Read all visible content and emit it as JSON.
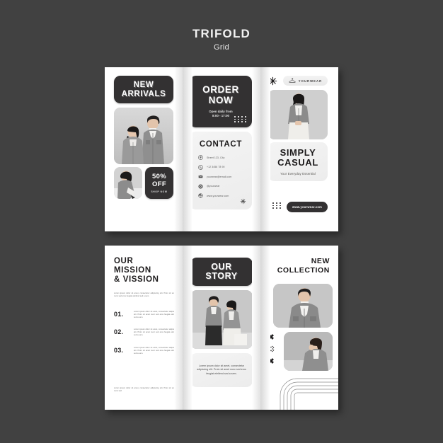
{
  "header": {
    "title": "TRIFOLD",
    "subtitle": "Grid"
  },
  "theme": {
    "background": "#414141",
    "paper": "#ffffff",
    "dark": "#333132",
    "light_panel": "#f1f1f1",
    "text_dark": "#1d1b1c",
    "text_muted": "#5d5d5d"
  },
  "lorem": {
    "short": "Lorem ipsum dolor sit amet, consectetur adipiscing elit. Proin sit amet nunc sed eros feugiat eleifend sed a sem.",
    "item": "Lorem ipsum dolor sit amet, consectetur adipiscing elit. Proin sit amet nunc sed eros feugiat eleifend sed a sem.",
    "foot": "Lorem ipsum dolor sit amet, consectetur adipiscing elit. Proin sit amet nunc sed",
    "story": "Lorem ipsum dolor sit amet, consectetur adipiscing elit. Proin sit amet nunc sed eros feugiat eleifend sed a sem."
  },
  "brochure_front": {
    "left_panel": {
      "badge": "NEW ARRIVALS",
      "photo_main": "couple-in-grey-blazers-photo",
      "photo_small": "woman-grey-blazer-photo",
      "offer_title": "50% OFF",
      "offer_cta": "SHOP NOW"
    },
    "middle_panel": {
      "order_title": "ORDER NOW",
      "hours": "Open daily from 8:00 - 17:00",
      "hours_line1": "Open daily from",
      "hours_line2": "8:00 - 17:00",
      "contact_title": "CONTACT",
      "contact_rows": [
        {
          "icon": "location-pin-icon",
          "text": "Street 123, City"
        },
        {
          "icon": "phone-icon",
          "text": "+12 3456 78 90"
        },
        {
          "icon": "envelope-icon",
          "text": "yourwear@email.com"
        },
        {
          "icon": "instagram-icon",
          "text": "@yourwear"
        },
        {
          "icon": "globe-icon",
          "text": "www.yourwear.com"
        }
      ]
    },
    "right_panel": {
      "logo_text": "YOURWEAR",
      "logo_icon": "clothes-hanger-icon",
      "star_icon": "asterisk-star-icon",
      "photo": "woman-grey-blazer-standing-photo",
      "title": "SIMPLY CASUAL",
      "title_line1": "SIMPLY",
      "title_line2": "CASUAL",
      "tagline": "Your Everyday Essential",
      "button_label": "www.yourwear.com"
    }
  },
  "brochure_inside": {
    "left_panel": {
      "title_line1": "OUR",
      "title_line2": "MISSION",
      "title_line3": "& VISSION",
      "items": [
        {
          "number": "01.",
          "text": "Lorem ipsum dolor sit amet, consectetur adipiscing elit. Proin sit amet nunc sed eros feugiat eleifend sed a sem."
        },
        {
          "number": "02.",
          "text": "Lorem ipsum dolor sit amet, consectetur adipiscing elit. Proin sit amet nunc sed eros feugiat eleifend sed a sem."
        },
        {
          "number": "03.",
          "text": "Lorem ipsum dolor sit amet, consectetur adipiscing elit. Proin sit amet nunc sed eros feugiat eleifend sed a sem."
        }
      ]
    },
    "middle_panel": {
      "badge": "OUR STORY",
      "badge_line1": "OUR",
      "badge_line2": "STORY",
      "photo": "couple-standing-grey-outfits-photo"
    },
    "right_panel": {
      "title_line1": "NEW",
      "title_line2": "COLLECTION",
      "photo_top": "man-grey-jacket-photo",
      "photo_bottom": "woman-grey-blazer-seated-photo",
      "marks": [
        "x-mark-filled-icon",
        "x-mark-outline-icon",
        "x-mark-filled-icon"
      ],
      "arcs": "concentric-arc-lines-decoration"
    }
  }
}
